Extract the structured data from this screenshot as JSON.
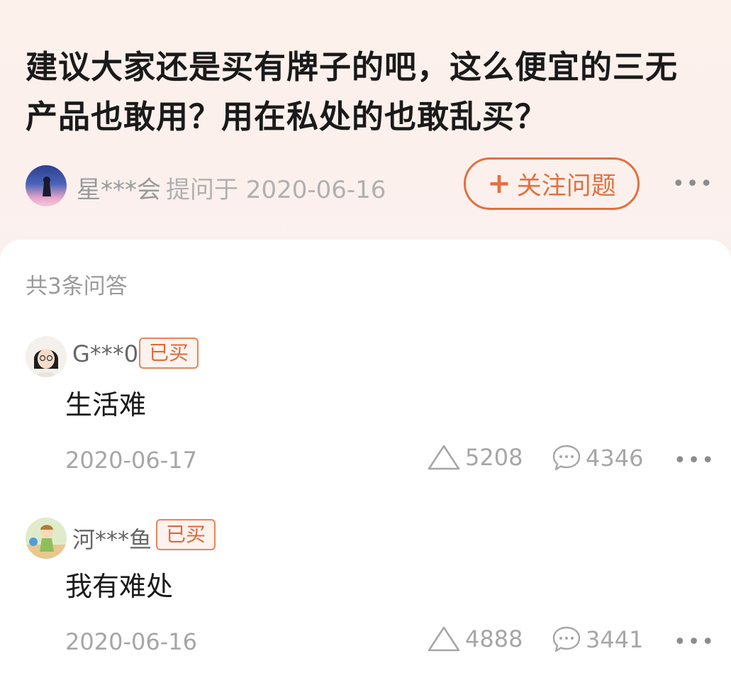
{
  "question": {
    "title": "建议大家还是买有牌子的吧，这么便宜的三无产品也敢用？用在私处的也敢乱买？",
    "asker_name": "星***会",
    "asked_time": "提问于 2020-06-16",
    "follow_plus": "+",
    "follow_label": "关注问题",
    "more": "•••"
  },
  "answers_header": {
    "count_label": "共3条问答"
  },
  "answers": [
    {
      "user": "G***0",
      "badge": "已买",
      "text": "生活难",
      "date": "2020-06-17",
      "likes": "5208",
      "comments": "4346",
      "more": "•••"
    },
    {
      "user": "河***鱼",
      "badge": "已买",
      "text": "我有难处",
      "date": "2020-06-16",
      "likes": "4888",
      "comments": "3441",
      "more": "•••"
    }
  ],
  "colors": {
    "accent": "#e3703f",
    "header_bg": "#fdf1ec",
    "badge_bg": "#fdf3ee"
  },
  "icons": {
    "like": "triangle-up-icon",
    "comment": "chat-bubble-icon",
    "more": "more-dots-icon"
  }
}
